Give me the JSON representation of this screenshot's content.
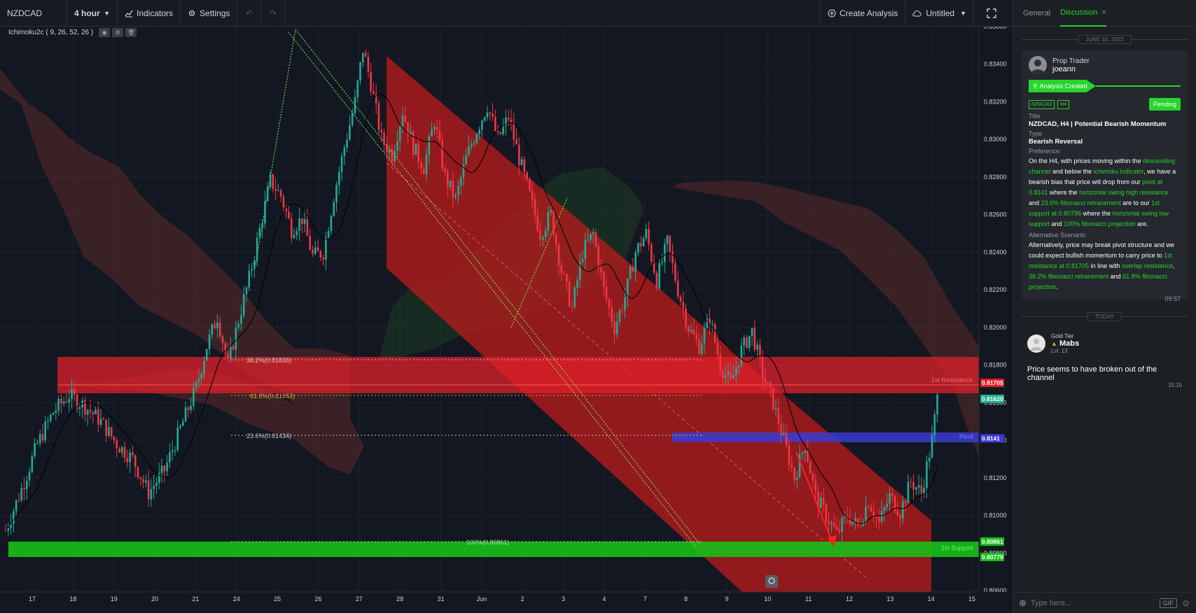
{
  "toolbar": {
    "symbol": "NZDCAD",
    "interval": "4 hour",
    "indicators_label": "Indicators",
    "settings_label": "Settings",
    "create_analysis_label": "Create Analysis",
    "layout_name": "Untitled"
  },
  "indicator": {
    "label": "Ichimoku2c ( 9, 26, 52, 26 )"
  },
  "price_axis": {
    "ticks": [
      "0.83600",
      "0.83400",
      "0.83200",
      "0.83000",
      "0.82800",
      "0.82600",
      "0.82400",
      "0.82200",
      "0.82000",
      "0.81800",
      "0.81600",
      "0.81400",
      "0.81200",
      "0.81000",
      "0.80800",
      "0.80600"
    ],
    "markers": [
      {
        "label": "0.81705",
        "color": "#e0202a"
      },
      {
        "label": "0.81620",
        "color": "#22b08c"
      },
      {
        "label": "0.8141",
        "color": "#3b3bd0"
      },
      {
        "label": "0.80861",
        "color": "#18c018"
      },
      {
        "label": "0.80779",
        "color": "#18c018"
      }
    ]
  },
  "time_axis": {
    "ticks": [
      "17",
      "18",
      "19",
      "20",
      "21",
      "24",
      "25",
      "26",
      "27",
      "28",
      "31",
      "Jun",
      "2",
      "3",
      "4",
      "7",
      "8",
      "9",
      "10",
      "11",
      "12",
      "13",
      "14",
      "15"
    ]
  },
  "chart_labels": {
    "fib_382": "38.2%(0.81836)",
    "fib_618": "61.8%(0.81653)",
    "fib_236": "23.6%(0.81434)",
    "fib_100": "100%(0.80861)",
    "resistance_1": "1st Resistance",
    "pivot": "Pivot",
    "support_1": "1st Support"
  },
  "chart_data": {
    "type": "candlestick",
    "symbol": "NZDCAD",
    "interval": "4 hour",
    "y_range": [
      0.806,
      0.836
    ],
    "x_ticks": [
      "17",
      "18",
      "19",
      "20",
      "21",
      "24",
      "25",
      "26",
      "27",
      "28",
      "31",
      "Jun",
      "2",
      "3",
      "4",
      "7",
      "8",
      "9",
      "10",
      "11",
      "12",
      "13",
      "14",
      "15"
    ],
    "levels": [
      {
        "name": "1st Resistance",
        "value": 0.81705
      },
      {
        "name": "Pivot",
        "value": 0.8141
      },
      {
        "name": "1st Support",
        "value": 0.80779
      },
      {
        "name": "38.2%",
        "value": 0.81836
      },
      {
        "name": "61.8%",
        "value": 0.81653
      },
      {
        "name": "23.6%",
        "value": 0.81434
      },
      {
        "name": "100%",
        "value": 0.80861
      }
    ],
    "close_path": [
      [
        0,
        0.8092
      ],
      [
        6,
        0.8114
      ],
      [
        12,
        0.8138
      ],
      [
        18,
        0.8155
      ],
      [
        24,
        0.8164
      ],
      [
        30,
        0.8158
      ],
      [
        36,
        0.815
      ],
      [
        42,
        0.8138
      ],
      [
        48,
        0.813
      ],
      [
        54,
        0.8112
      ],
      [
        60,
        0.8124
      ],
      [
        66,
        0.8146
      ],
      [
        72,
        0.8168
      ],
      [
        76,
        0.819
      ],
      [
        80,
        0.8206
      ],
      [
        84,
        0.818
      ],
      [
        88,
        0.8204
      ],
      [
        92,
        0.8226
      ],
      [
        96,
        0.8252
      ],
      [
        100,
        0.8278
      ],
      [
        104,
        0.827
      ],
      [
        108,
        0.8252
      ],
      [
        112,
        0.8258
      ],
      [
        116,
        0.8238
      ],
      [
        120,
        0.824
      ],
      [
        124,
        0.827
      ],
      [
        128,
        0.8296
      ],
      [
        132,
        0.832
      ],
      [
        135,
        0.8348
      ],
      [
        138,
        0.833
      ],
      [
        142,
        0.83
      ],
      [
        146,
        0.8292
      ],
      [
        150,
        0.8315
      ],
      [
        154,
        0.8296
      ],
      [
        158,
        0.8285
      ],
      [
        162,
        0.831
      ],
      [
        166,
        0.828
      ],
      [
        170,
        0.8268
      ],
      [
        174,
        0.829
      ],
      [
        178,
        0.8305
      ],
      [
        182,
        0.8318
      ],
      [
        186,
        0.83
      ],
      [
        190,
        0.8312
      ],
      [
        194,
        0.829
      ],
      [
        198,
        0.827
      ],
      [
        202,
        0.825
      ],
      [
        206,
        0.826
      ],
      [
        210,
        0.823
      ],
      [
        214,
        0.821
      ],
      [
        218,
        0.824
      ],
      [
        222,
        0.825
      ],
      [
        226,
        0.822
      ],
      [
        230,
        0.82
      ],
      [
        234,
        0.8216
      ],
      [
        238,
        0.824
      ],
      [
        242,
        0.825
      ],
      [
        246,
        0.8225
      ],
      [
        250,
        0.8245
      ],
      [
        254,
        0.822
      ],
      [
        258,
        0.82
      ],
      [
        262,
        0.819
      ],
      [
        266,
        0.8205
      ],
      [
        270,
        0.818
      ],
      [
        274,
        0.817
      ],
      [
        278,
        0.8188
      ],
      [
        282,
        0.8198
      ],
      [
        286,
        0.8175
      ],
      [
        290,
        0.816
      ],
      [
        294,
        0.814
      ],
      [
        298,
        0.812
      ],
      [
        302,
        0.8138
      ],
      [
        306,
        0.811
      ],
      [
        310,
        0.81
      ],
      [
        314,
        0.809
      ],
      [
        318,
        0.81
      ],
      [
        322,
        0.8094
      ],
      [
        326,
        0.8108
      ],
      [
        330,
        0.8096
      ],
      [
        334,
        0.811
      ],
      [
        338,
        0.8102
      ],
      [
        342,
        0.8118
      ],
      [
        346,
        0.8112
      ],
      [
        350,
        0.814
      ],
      [
        352,
        0.8162
      ]
    ]
  },
  "sidebar": {
    "tabs": [
      {
        "label": "General",
        "active": false
      },
      {
        "label": "Discussion",
        "active": true
      }
    ],
    "date_sep_1": "JUNE 10, 2022",
    "card": {
      "role": "Prop Trader",
      "author": "joeann",
      "status_label": "Analysis Created",
      "tag_symbol": "NZDCAD",
      "tag_interval": "H4",
      "pending_label": "Pending",
      "title_label": "Title",
      "title_value": "NZDCAD, H4 | Potential Bearish Momentum",
      "type_label": "Type",
      "type_value": "Bearish Reversal",
      "pref_label": "Preference:",
      "pref_segments": [
        {
          "t": "On the H4, with prices moving within the ",
          "g": false
        },
        {
          "t": "descending channel",
          "g": true
        },
        {
          "t": " and below the ",
          "g": false
        },
        {
          "t": "ichimoku indicator",
          "g": true
        },
        {
          "t": ", we have a bearish bias that price will drop from our ",
          "g": false
        },
        {
          "t": "pivot at 0.8141",
          "g": true
        },
        {
          "t": " where the ",
          "g": false
        },
        {
          "t": "horizontal swing high resistance",
          "g": true
        },
        {
          "t": " and ",
          "g": false
        },
        {
          "t": "23.6% fibonacci retracement",
          "g": true
        },
        {
          "t": " are to our ",
          "g": false
        },
        {
          "t": "1st support at 0.80796",
          "g": true
        },
        {
          "t": " where the ",
          "g": false
        },
        {
          "t": "horizontal swing low support",
          "g": true
        },
        {
          "t": " and ",
          "g": false
        },
        {
          "t": "100% fibonacci projection",
          "g": true
        },
        {
          "t": " are.",
          "g": false
        }
      ],
      "alt_label": "Alternative Scenario:",
      "alt_segments": [
        {
          "t": "Alternatively, price may break pivot structure and we could expect bullish momentum to carry price to ",
          "g": false
        },
        {
          "t": "1st resistance at 0.81705",
          "g": true
        },
        {
          "t": " in line with ",
          "g": false
        },
        {
          "t": "overlap resistance",
          "g": true
        },
        {
          "t": ", ",
          "g": false
        },
        {
          "t": "38.2% fibonacci retracement",
          "g": true
        },
        {
          "t": " and ",
          "g": false
        },
        {
          "t": "61.8% fibonacci projection",
          "g": true
        },
        {
          "t": ".",
          "g": false
        }
      ],
      "time": "09:57"
    },
    "date_sep_2": "TODAY",
    "comment": {
      "tier": "Gold Tier",
      "name": "Mabs",
      "level": "Lvl. 13",
      "text": "Price seems to have broken out of the channel",
      "time": "15:15"
    },
    "input_placeholder": "Type here...",
    "gif_label": "GIF"
  },
  "colors": {
    "accent_green": "#27d52b",
    "bull": "#22ab94",
    "bear": "#f23645",
    "channel": "#c41a1a"
  }
}
